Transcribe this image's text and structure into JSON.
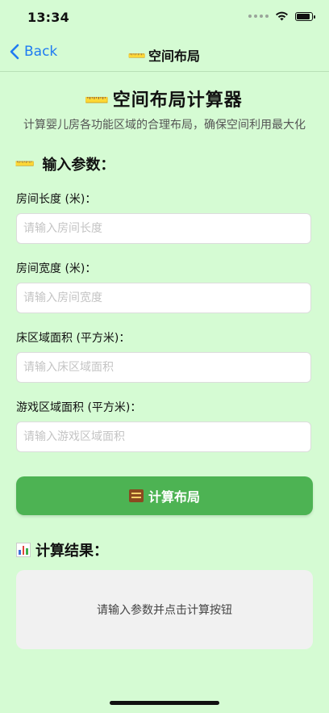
{
  "status_bar": {
    "time": "13:34"
  },
  "nav": {
    "back_label": "Back",
    "title": "空间布局",
    "title_icon": "📏"
  },
  "header": {
    "title": "空间布局计算器",
    "title_icon": "📏",
    "subtitle": "计算婴儿房各功能区域的合理布局，确保空间利用最大化"
  },
  "input_section": {
    "title": "输入参数：",
    "icon": "📏",
    "fields": [
      {
        "label": "房间长度 (米)：",
        "placeholder": "请输入房间长度",
        "value": ""
      },
      {
        "label": "房间宽度 (米)：",
        "placeholder": "请输入房间宽度",
        "value": ""
      },
      {
        "label": "床区域面积 (平方米)：",
        "placeholder": "请输入床区域面积",
        "value": ""
      },
      {
        "label": "游戏区域面积 (平方米)：",
        "placeholder": "请输入游戏区域面积",
        "value": ""
      }
    ]
  },
  "calculate_button": {
    "label": "计算布局",
    "icon": "abacus-icon"
  },
  "result_section": {
    "title": "计算结果：",
    "icon": "bar-chart-icon",
    "placeholder_text": "请输入参数并点击计算按钮"
  },
  "colors": {
    "background": "#d5fbd3",
    "accent_green": "#4db353",
    "link_blue": "#1f7bf2"
  }
}
